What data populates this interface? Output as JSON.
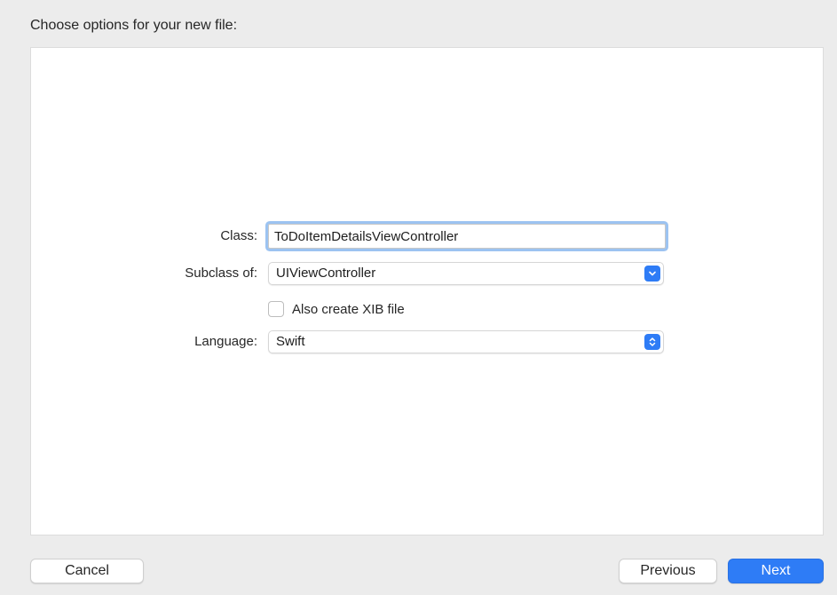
{
  "dialog": {
    "header": "Choose options for your new file:"
  },
  "form": {
    "class_label": "Class:",
    "class_value": "ToDoItemDetailsViewController",
    "subclass_label": "Subclass of:",
    "subclass_value": "UIViewController",
    "xib_checkbox_label": "Also create XIB file",
    "xib_checked": false,
    "language_label": "Language:",
    "language_value": "Swift"
  },
  "buttons": {
    "cancel": "Cancel",
    "previous": "Previous",
    "next": "Next"
  },
  "icons": {
    "subclass_dropdown": "chevron-down-icon",
    "language_popup": "chevron-up-down-icon"
  },
  "colors": {
    "accent": "#2e7cf6",
    "focus_ring": "#9cc3f1",
    "window_bg": "#ececec",
    "panel_bg": "#ffffff"
  }
}
